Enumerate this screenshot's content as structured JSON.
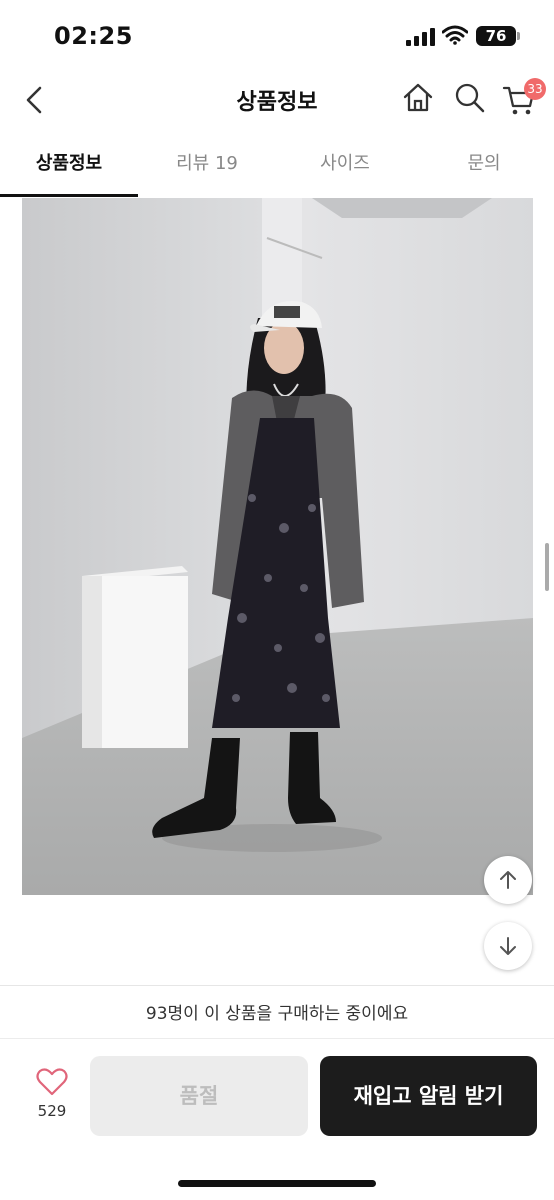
{
  "status_bar": {
    "time": "02:25",
    "battery": "76"
  },
  "header": {
    "title": "상품정보",
    "cart_count": "33"
  },
  "tabs": [
    {
      "label": "상품정보",
      "active": true
    },
    {
      "label": "리뷰 19",
      "active": false
    },
    {
      "label": "사이즈",
      "active": false
    },
    {
      "label": "문의",
      "active": false
    }
  ],
  "footer": {
    "buyers_text": "93명이 이 상품을 구매하는 중이에요",
    "like_count": "529",
    "soldout_label": "품절",
    "restock_label": "재입고 알림 받기"
  },
  "colors": {
    "accent_badge": "#f06a6a",
    "heart_outline": "#e0657a",
    "primary_button": "#1c1c1c",
    "disabled_button": "#ececec"
  },
  "icons": [
    "back-icon",
    "home-icon",
    "search-icon",
    "cart-icon",
    "heart-icon",
    "arrow-up-icon",
    "arrow-down-icon"
  ]
}
